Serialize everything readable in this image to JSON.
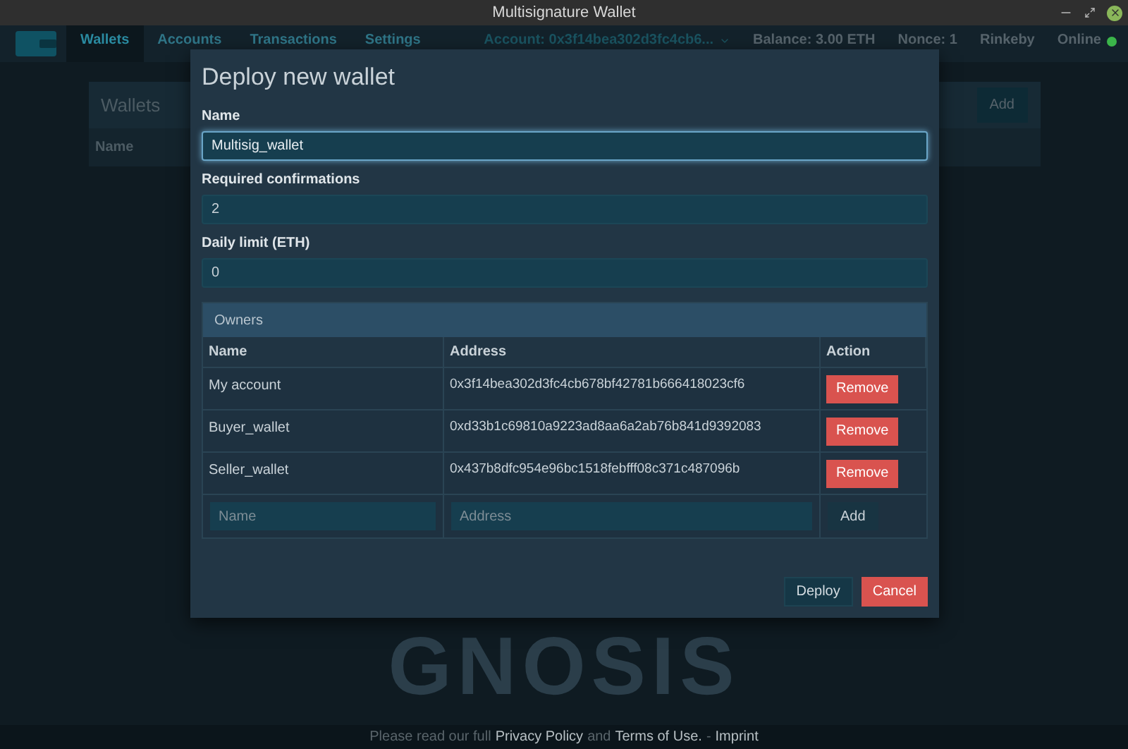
{
  "window": {
    "title": "Multisignature Wallet"
  },
  "nav": {
    "tabs": [
      {
        "label": "Wallets",
        "selected": true
      },
      {
        "label": "Accounts",
        "selected": false
      },
      {
        "label": "Transactions",
        "selected": false
      },
      {
        "label": "Settings",
        "selected": false
      }
    ],
    "account": "Account: 0x3f14bea302d3fc4cb6...",
    "balance": "Balance: 3.00 ETH",
    "nonce": "Nonce: 1",
    "network": "Rinkeby",
    "status": {
      "label": "Online",
      "color": "#3bb54a"
    }
  },
  "wallets_card": {
    "title": "Wallets",
    "add_button": "Add",
    "columns": [
      "Name"
    ]
  },
  "dialog": {
    "title": "Deploy new wallet",
    "fields": [
      {
        "label": "Name",
        "value": "Multisig_wallet",
        "focused": true
      },
      {
        "label": "Required confirmations",
        "value": "2",
        "focused": false
      },
      {
        "label": "Daily limit (ETH)",
        "value": "0",
        "focused": false
      }
    ],
    "owners": {
      "title": "Owners",
      "columns": [
        "Name",
        "Address",
        "Action"
      ],
      "rows": [
        {
          "name": "My account",
          "address": "0x3f14bea302d3fc4cb678bf42781b666418023cf6",
          "action": "Remove"
        },
        {
          "name": "Buyer_wallet",
          "address": "0xd33b1c69810a9223ad8aa6a2ab76b841d9392083",
          "action": "Remove"
        },
        {
          "name": "Seller_wallet",
          "address": "0x437b8dfc954e96bc1518febfff08c371c487096b",
          "action": "Remove"
        }
      ],
      "new_row": {
        "name_placeholder": "Name",
        "address_placeholder": "Address",
        "add_button": "Add"
      }
    },
    "buttons": [
      {
        "label": "Deploy",
        "kind": "primary"
      },
      {
        "label": "Cancel",
        "kind": "danger"
      }
    ]
  },
  "watermark": "GNOSIS",
  "footer": {
    "prefix": "Please read our full",
    "privacy": "Privacy Policy",
    "and": "and",
    "terms": "Terms of Use.",
    "sep": "-",
    "imprint": "Imprint"
  }
}
